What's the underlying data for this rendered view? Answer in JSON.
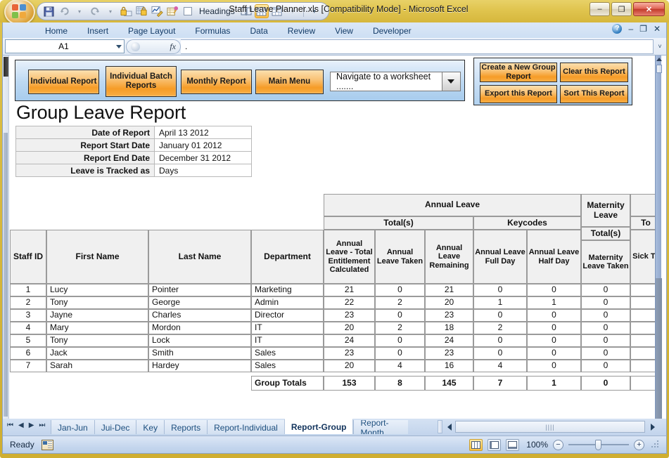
{
  "window": {
    "title": "Staff Leave Planner.xls  [Compatibility Mode] - Microsoft Excel",
    "minimize_label": "–",
    "maximize_label": "❐",
    "close_label": "✕"
  },
  "quick_access": {
    "items": [
      {
        "name": "save-icon",
        "glyph": "💾"
      },
      {
        "name": "undo-icon",
        "glyph": "↶"
      },
      {
        "name": "undo-dropdown-icon",
        "glyph": "˅"
      },
      {
        "name": "redo-icon",
        "glyph": "↷"
      },
      {
        "name": "redo-dropdown-icon",
        "glyph": "˅"
      },
      {
        "name": "protect-sheet-icon",
        "glyph": "🔒"
      },
      {
        "name": "protect-workbook-icon",
        "glyph": "🔐"
      },
      {
        "name": "edit-chart-icon",
        "glyph": "📈"
      },
      {
        "name": "format-icon",
        "glyph": "🎨"
      }
    ],
    "headings_toggle_label": "Headings",
    "more_icons": [
      {
        "name": "book-view-icon",
        "glyph": "📖"
      },
      {
        "name": "gridlines-icon",
        "glyph": "⌗"
      },
      {
        "name": "table-style-icon",
        "glyph": "▤"
      }
    ],
    "customize_caret": "≡"
  },
  "ribbon": {
    "tabs": [
      {
        "label": "Home"
      },
      {
        "label": "Insert"
      },
      {
        "label": "Page Layout"
      },
      {
        "label": "Formulas"
      },
      {
        "label": "Data"
      },
      {
        "label": "Review"
      },
      {
        "label": "View"
      },
      {
        "label": "Developer"
      }
    ],
    "help_label": "?",
    "minimize_ribbon_label": "–",
    "restore_label": "❐",
    "close_label": "✕"
  },
  "formula_bar": {
    "name_box_value": "A1",
    "formula_value": ".",
    "fx_label": "fx",
    "expand_caret": "˅"
  },
  "toolbar_buttons": {
    "left_panel": [
      {
        "label": "Individual Report"
      },
      {
        "label": "Individual Batch Reports"
      },
      {
        "label": "Monthly Report"
      },
      {
        "label": "Main Menu"
      }
    ],
    "navigate_select": {
      "value": "Navigate to a worksheet .......",
      "caret": "▼"
    },
    "right_panel": [
      {
        "label": "Create a New Group Report"
      },
      {
        "label": "Clear this Report"
      },
      {
        "label": "Export this Report"
      },
      {
        "label": "Sort This Report"
      }
    ]
  },
  "report": {
    "title": "Group Leave Report",
    "info_rows": [
      {
        "label": "Date of Report",
        "value": "April 13 2012"
      },
      {
        "label": "Report Start Date",
        "value": "January 01 2012"
      },
      {
        "label": "Report End Date",
        "value": "December 31 2012"
      },
      {
        "label": "Leave is Tracked as",
        "value": "Days"
      }
    ]
  },
  "table": {
    "group_headers": [
      {
        "label": "Annual Leave"
      },
      {
        "label": "Maternity Leave"
      },
      {
        "label": ""
      }
    ],
    "sub_headers": [
      {
        "label": "Total(s)"
      },
      {
        "label": "Keycodes"
      },
      {
        "label": "Total(s)"
      },
      {
        "label": "To"
      }
    ],
    "columns": [
      {
        "label": "Staff ID"
      },
      {
        "label": "First Name"
      },
      {
        "label": "Last Name"
      },
      {
        "label": "Department"
      },
      {
        "label": "Annual Leave - Total Entitlement Calculated"
      },
      {
        "label": "Annual Leave Taken"
      },
      {
        "label": "Annual Leave Remaining"
      },
      {
        "label": "Annual Leave Full Day"
      },
      {
        "label": "Annual Leave Half Day"
      },
      {
        "label": "Maternity Leave Taken"
      },
      {
        "label": "Sick Ta"
      }
    ],
    "rows": [
      {
        "staff_id": "1",
        "first_name": "Lucy",
        "last_name": "Pointer",
        "department": "Marketing",
        "entitlement": "21",
        "taken": "0",
        "remaining": "21",
        "full_day": "0",
        "half_day": "0",
        "maternity": "0",
        "sick": ""
      },
      {
        "staff_id": "2",
        "first_name": "Tony",
        "last_name": "George",
        "department": "Admin",
        "entitlement": "22",
        "taken": "2",
        "remaining": "20",
        "full_day": "1",
        "half_day": "1",
        "maternity": "0",
        "sick": ""
      },
      {
        "staff_id": "3",
        "first_name": "Jayne",
        "last_name": "Charles",
        "department": "Director",
        "entitlement": "23",
        "taken": "0",
        "remaining": "23",
        "full_day": "0",
        "half_day": "0",
        "maternity": "0",
        "sick": ""
      },
      {
        "staff_id": "4",
        "first_name": "Mary",
        "last_name": "Mordon",
        "department": "IT",
        "entitlement": "20",
        "taken": "2",
        "remaining": "18",
        "full_day": "2",
        "half_day": "0",
        "maternity": "0",
        "sick": ""
      },
      {
        "staff_id": "5",
        "first_name": "Tony",
        "last_name": "Lock",
        "department": "IT",
        "entitlement": "24",
        "taken": "0",
        "remaining": "24",
        "full_day": "0",
        "half_day": "0",
        "maternity": "0",
        "sick": ""
      },
      {
        "staff_id": "6",
        "first_name": "Jack",
        "last_name": "Smith",
        "department": "Sales",
        "entitlement": "23",
        "taken": "0",
        "remaining": "23",
        "full_day": "0",
        "half_day": "0",
        "maternity": "0",
        "sick": ""
      },
      {
        "staff_id": "7",
        "first_name": "Sarah",
        "last_name": "Hardey",
        "department": "Sales",
        "entitlement": "20",
        "taken": "4",
        "remaining": "16",
        "full_day": "4",
        "half_day": "0",
        "maternity": "0",
        "sick": ""
      }
    ],
    "totals": {
      "label": "Group Totals",
      "entitlement": "153",
      "taken": "8",
      "remaining": "145",
      "full_day": "7",
      "half_day": "1",
      "maternity": "0",
      "sick": ""
    }
  },
  "sheet_tabs": {
    "nav_first": "⏮",
    "nav_prev": "◀",
    "nav_next": "▶",
    "nav_last": "⏭",
    "tabs": [
      {
        "label": "Jan-Jun",
        "active": false
      },
      {
        "label": "Jui-Dec",
        "active": false
      },
      {
        "label": "Key",
        "active": false
      },
      {
        "label": "Reports",
        "active": false
      },
      {
        "label": "Report-Individual",
        "active": false
      },
      {
        "label": "Report-Group",
        "active": true
      },
      {
        "label": "Report-Month",
        "active": false
      }
    ],
    "hscroll_grip": "||||"
  },
  "status_bar": {
    "status_text": "Ready",
    "macro_record_icon": "record-macro-icon",
    "view_buttons": [
      {
        "name": "normal-view-button",
        "active": true
      },
      {
        "name": "page-layout-view-button",
        "active": false
      },
      {
        "name": "page-break-preview-button",
        "active": false
      }
    ],
    "zoom_level": "100%",
    "zoom_out_label": "−",
    "zoom_in_label": "+"
  },
  "colors": {
    "window_frame": "#d8b93f",
    "ribbon_blue": "#cddff3",
    "button_orange": "#f69c27",
    "panel_blue": "#bcd8f2",
    "header_gray": "#f0f0f0"
  }
}
